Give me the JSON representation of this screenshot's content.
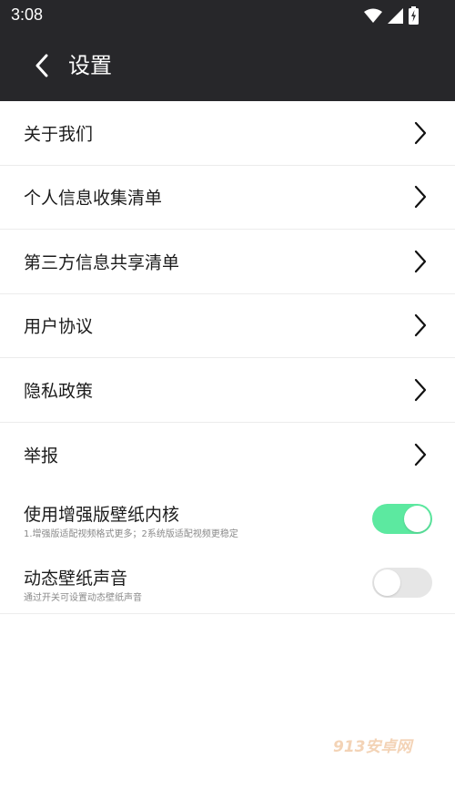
{
  "status_bar": {
    "time": "3:08",
    "icons": [
      "wifi-icon",
      "signal-icon",
      "battery-charging-icon"
    ]
  },
  "header": {
    "title": "设置",
    "back_icon": "chevron-left-icon"
  },
  "menu": {
    "items": [
      {
        "label": "关于我们"
      },
      {
        "label": "个人信息收集清单"
      },
      {
        "label": "第三方信息共享清单"
      },
      {
        "label": "用户协议"
      },
      {
        "label": "隐私政策"
      },
      {
        "label": "举报"
      }
    ]
  },
  "toggles": [
    {
      "title": "使用增强版壁纸内核",
      "description": "1.增强版适配视频格式更多；2系统版适配视频更稳定",
      "checked": true
    },
    {
      "title": "动态壁纸声音",
      "description": "通过开关可设置动态壁纸声音",
      "checked": false
    }
  ],
  "watermark": "913安卓网",
  "colors": {
    "header_bg": "#27272a",
    "switch_on": "#5ce9a0",
    "switch_off": "#e6e6e6",
    "watermark": "#f3d3b6"
  }
}
